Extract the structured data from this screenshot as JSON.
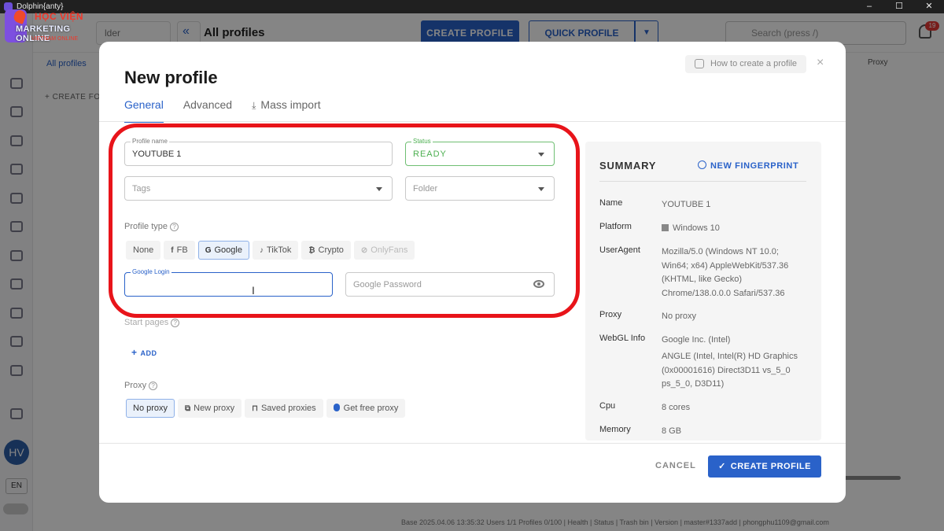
{
  "window": {
    "title": "Dolphin{anty}",
    "controls": [
      "–",
      "☐",
      "✕"
    ]
  },
  "logo": {
    "line1": "HỌC VIỆN",
    "line2": "MARKETING ONLINE",
    "line3": "VIETNAM ONLINE"
  },
  "background": {
    "folder_placeholder": "lder",
    "page_title": "All profiles",
    "create_profile": "CREATE PROFILE",
    "quick_profile": "QUICK PROFILE",
    "search_placeholder": "Search (press /)",
    "notif_count": "19",
    "all_profiles_tab": "All profiles",
    "create_folder": "+ CREATE FO",
    "proxy_col": "Proxy",
    "avatar": "HV",
    "lang": "EN",
    "status_bar": "Base 2025.04.06 13:35:32  Users 1/1  Profiles 0/100  |  Health  |  Status  |  Trash bin  |  Version  |  master#1337add  |  phongphu1109@gmail.com"
  },
  "modal": {
    "title": "New profile",
    "how_to": "How to create a profile",
    "close": "×",
    "tabs": [
      "General",
      "Advanced",
      "Mass import"
    ],
    "profile_name": {
      "label": "Profile name",
      "value": "YOUTUBE 1"
    },
    "status": {
      "label": "Status",
      "value": "READY"
    },
    "tags": {
      "placeholder": "Tags"
    },
    "folder": {
      "placeholder": "Folder"
    },
    "profile_type": {
      "label": "Profile type",
      "options": [
        "None",
        "FB",
        "Google",
        "TikTok",
        "Crypto",
        "OnlyFans"
      ],
      "selected": "Google"
    },
    "google_login": {
      "label": "Google Login",
      "value": ""
    },
    "google_password": {
      "placeholder": "Google Password"
    },
    "start_pages": {
      "label": "Start pages",
      "add": "ADD"
    },
    "proxy": {
      "label": "Proxy",
      "options": [
        "No proxy",
        "New proxy",
        "Saved proxies",
        "Get free proxy"
      ],
      "selected": "No proxy"
    },
    "summary": {
      "title": "SUMMARY",
      "new_fingerprint": "NEW FINGERPRINT",
      "rows": [
        {
          "key": "Name",
          "value": "YOUTUBE 1"
        },
        {
          "key": "Platform",
          "value": "Windows 10"
        },
        {
          "key": "UserAgent",
          "value": "Mozilla/5.0 (Windows NT 10.0; Win64; x64) AppleWebKit/537.36 (KHTML, like Gecko) Chrome/138.0.0.0 Safari/537.36"
        },
        {
          "key": "Proxy",
          "value": "No proxy"
        },
        {
          "key": "WebGL Info",
          "value": "Google Inc. (Intel)"
        },
        {
          "key": "",
          "value": "ANGLE (Intel, Intel(R) HD Graphics (0x00001616) Direct3D11 vs_5_0 ps_5_0, D3D11)"
        },
        {
          "key": "Cpu",
          "value": "8 cores"
        },
        {
          "key": "Memory",
          "value": "8 GB"
        }
      ]
    },
    "cancel": "CANCEL",
    "create": "CREATE PROFILE"
  },
  "colors": {
    "accent": "#2a62c9",
    "status_green": "#4caf50",
    "highlight_red": "#e8141a"
  }
}
